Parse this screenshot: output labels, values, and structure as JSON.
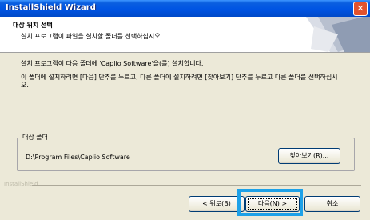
{
  "window": {
    "title": "InstallShield Wizard"
  },
  "header": {
    "title": "대상 위치 선택",
    "subtitle": "설치 프로그램이 파일을 설치할 폴더를 선택하십시오."
  },
  "body": {
    "line1": "설치 프로그램이 다음 폴더에 'Caplio Software'을(를) 설치합니다.",
    "line2": "이 폴더에 설치하려면 [다음] 단추를 누르고, 다른 폴더에 설치하려면 [찾아보기] 단추를 누르고 다른 폴더를 선택하십시오."
  },
  "destination": {
    "label": "대상 폴더",
    "path": "D:\\Program Files\\Caplio Software",
    "browse_label": "찾아보기(R)..."
  },
  "footer": {
    "brand": "InstallShield",
    "back_label": "< 뒤로(B)",
    "next_label": "다음(N) >",
    "cancel_label": "취소"
  },
  "colors": {
    "titlebar": "#0054e3",
    "highlight": "#1da1e8",
    "dialog_bg": "#ece9d8"
  }
}
